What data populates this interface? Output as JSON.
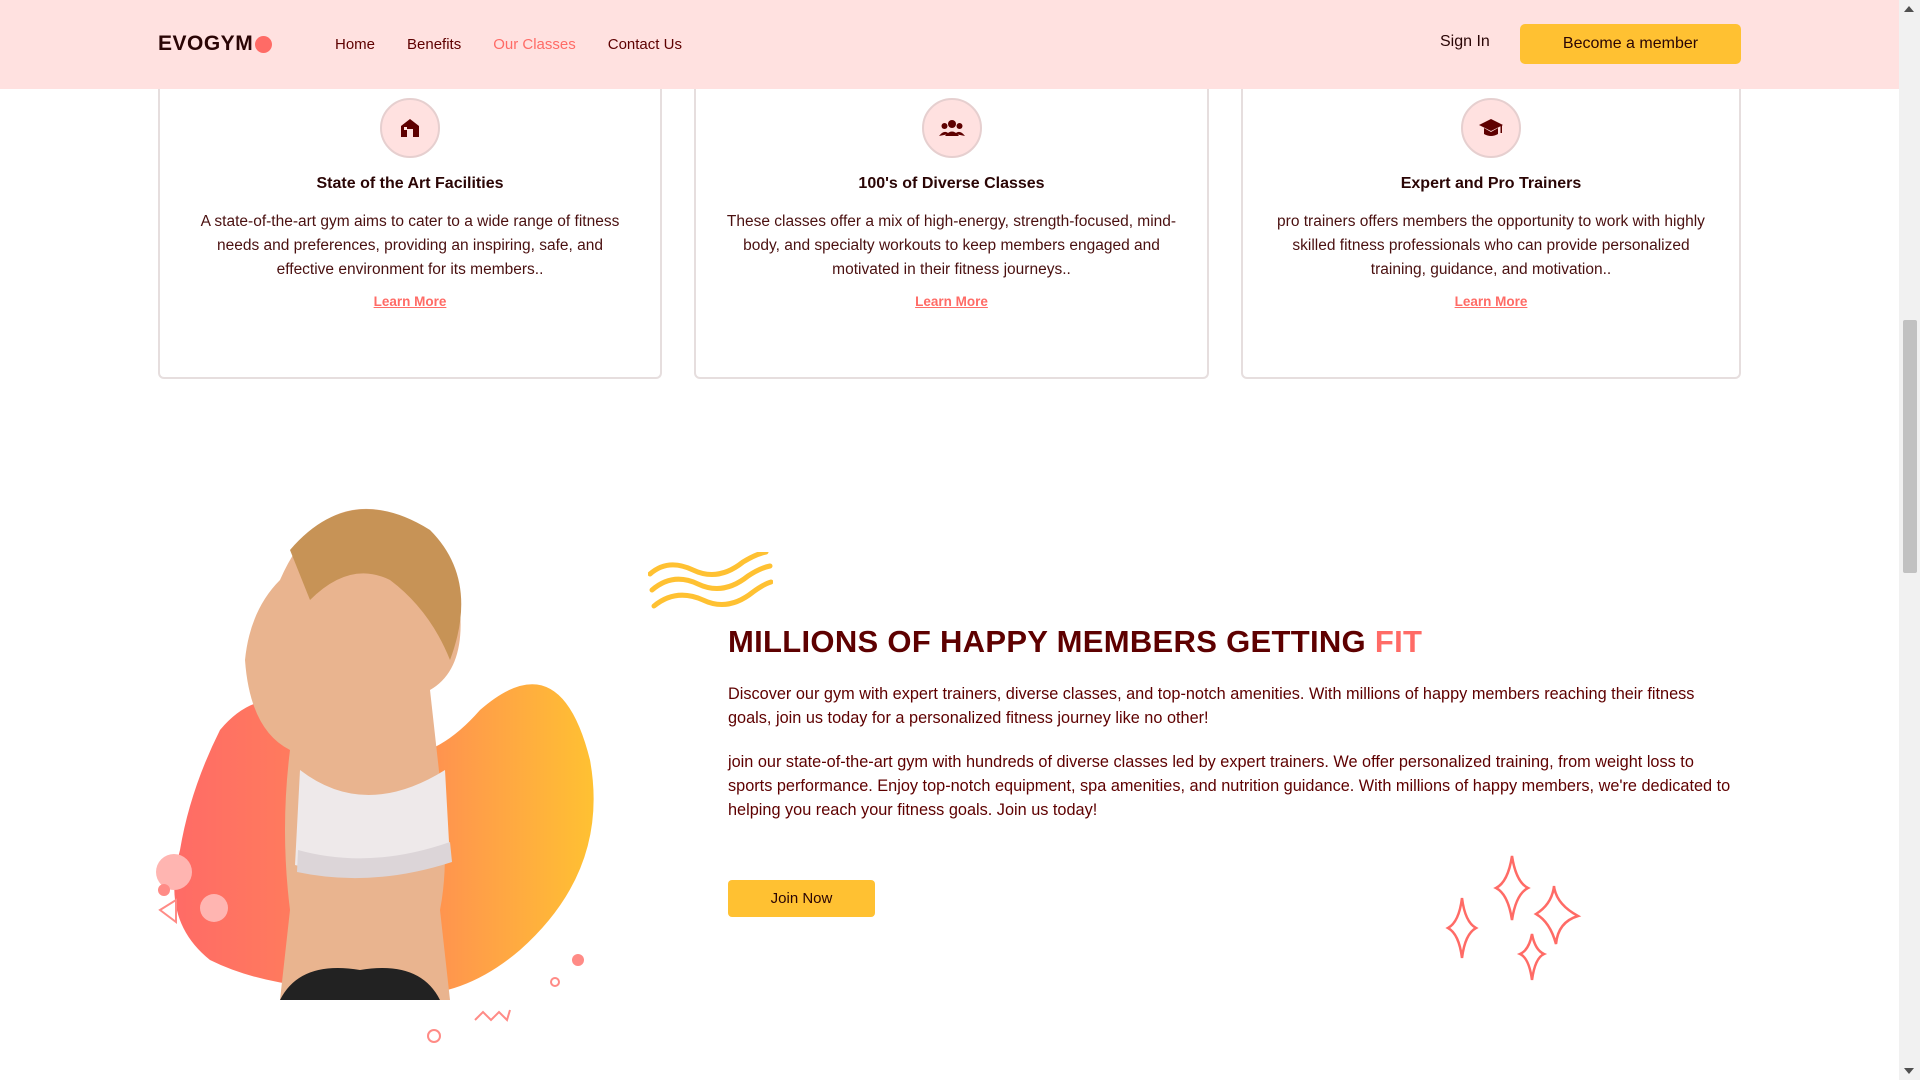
{
  "nav": {
    "logo": "EVOGYM",
    "links": [
      "Home",
      "Benefits",
      "Our Classes",
      "Contact Us"
    ],
    "active_link": "Our Classes",
    "sign_in": "Sign In",
    "cta": "Become a member"
  },
  "benefits": [
    {
      "icon": "home-icon",
      "title": "State of the Art Facilities",
      "description": "A state-of-the-art gym aims to cater to a wide range of fitness needs and preferences, providing an inspiring, safe, and effective environment for its members..",
      "link": "Learn More"
    },
    {
      "icon": "users-icon",
      "title": "100's of Diverse Classes",
      "description": "These classes offer a mix of high-energy, strength-focused, mind-body, and specialty workouts to keep members engaged and motivated in their fitness journeys..",
      "link": "Learn More"
    },
    {
      "icon": "graduation-cap-icon",
      "title": "Expert and Pro Trainers",
      "description": "pro trainers offers members the opportunity to work with highly skilled fitness professionals who can provide personalized training, guidance, and motivation..",
      "link": "Learn More"
    }
  ],
  "members_section": {
    "headline": "MILLIONS OF HAPPY MEMBERS GETTING",
    "headline_accent": "FIT",
    "paragraph_1": "Discover our gym with expert trainers, diverse classes, and top-notch amenities. With millions of happy members reaching their fitness goals, join us today for a personalized fitness journey like no other!",
    "paragraph_2": "join our state-of-the-art gym with hundreds of diverse classes led by expert trainers. We offer personalized training, from weight loss to sports performance. Enjoy top-notch equipment, spa amenities, and nutrition guidance. With millions of happy members, we're dedicated to helping you reach your fitness goals. Join us today!",
    "cta": "Join Now"
  },
  "colors": {
    "nav_bg": "#ffe1e0",
    "primary": "#ff6b66",
    "secondary": "#ffc132",
    "text_dark": "#5e0000"
  }
}
